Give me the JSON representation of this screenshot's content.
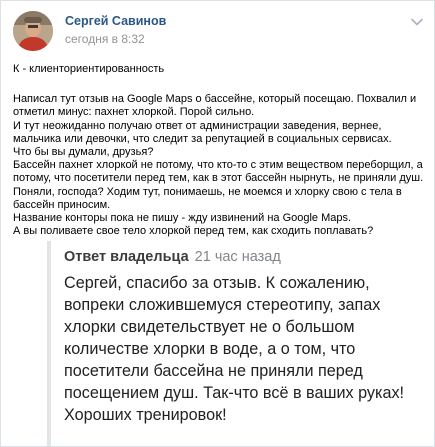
{
  "post": {
    "author": "Сергей Савинов",
    "time": "сегодня в 8:32",
    "headline": "К - клиенториентированность",
    "paragraphs": [
      "Написал тут отзыв на Google Maps о бассейне, который посещаю. Похвалил и отметил минус: пахнет хлоркой. Порой сильно.",
      "И тут неожиданно получаю ответ от администрации заведения, вернее, мальчика или девочки, что следит за репутацией в социальных сервисах.",
      "Что бы вы думали, друзья?",
      "Бассейн пахнет хлоркой не потому, что кто-то с этим веществом переборщил, а потому, что посетители перед тем, как в этот бассейн нырнуть, не приняли душ. Поняли, господа? Ходим тут, понимаешь, не моемся и хлорку свою с тела в бассейн приносим.",
      "Название конторы пока не пишу - жду извинений на Google Maps.",
      "А вы поливаете свое тело хлоркой перед тем, как сходить поплавать?"
    ]
  },
  "reply": {
    "owner_label": "Ответ владельца",
    "when": "21 час назад",
    "text": "Сергей, спасибо за отзыв. К сожалению, вопреки сложившемуся стереотипу, запах хлорки свидетельствует не о большом количестве хлорки в воде, а о том, что посетители бассейна не приняли перед посещением душ. Так-что всё в ваших руках! Хороших тренировок!"
  },
  "icons": {
    "avatar": "avatar",
    "menu": "chevron-down-icon"
  },
  "colors": {
    "author_link": "#2a5885",
    "muted": "#939393",
    "quote_border": "#e3e4e6"
  }
}
